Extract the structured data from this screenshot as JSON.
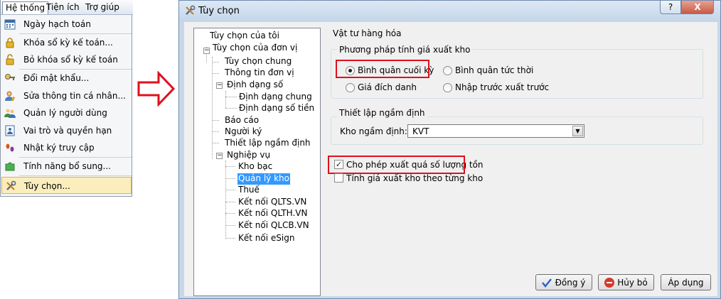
{
  "menu": {
    "bar": [
      "Hệ thống",
      "Tiện ích",
      "Trợ giúp"
    ],
    "items": [
      {
        "label": "Ngày hạch toán",
        "icon": "calendar-icon"
      },
      {
        "label": "Khóa sổ kỳ kế toán...",
        "icon": "lock-icon"
      },
      {
        "label": "Bỏ khóa sổ kỳ kế toán",
        "icon": "unlock-icon"
      },
      {
        "label": "Đổi mật khẩu...",
        "icon": "key-icon"
      },
      {
        "label": "Sửa thông tin cá nhân...",
        "icon": "user-edit-icon"
      },
      {
        "label": "Quản lý người dùng",
        "icon": "users-icon"
      },
      {
        "label": "Vai trò và quyền hạn",
        "icon": "role-icon"
      },
      {
        "label": "Nhật ký truy cập",
        "icon": "footprint-icon"
      },
      {
        "label": "Tính năng bổ sung...",
        "icon": "puzzle-icon"
      },
      {
        "label": "Tùy chọn...",
        "icon": "tools-icon"
      }
    ]
  },
  "dialog": {
    "title": "Tùy chọn",
    "help": "?",
    "close": "X",
    "tree": [
      "Tùy chọn của tôi",
      "Tùy chọn của đơn vị",
      "Tùy chọn chung",
      "Thông tin đơn vị",
      "Định dạng số",
      "Định dạng chung",
      "Định dạng số tiền",
      "Báo cáo",
      "Người ký",
      "Thiết lập ngầm định",
      "Nghiệp vụ",
      "Kho bạc",
      "Quản lý kho",
      "Thuế",
      "Kết nối QLTS.VN",
      "Kết nối QLTH.VN",
      "Kết nối QLCB.VN",
      "Kết nối eSign"
    ],
    "section_title": "Vật tư hàng hóa",
    "method_group": "Phương pháp tính giá xuất kho",
    "methods": [
      "Bình quân cuối kỳ",
      "Bình quân tức thời",
      "Giá đích danh",
      "Nhập trước xuất trước"
    ],
    "default_group": "Thiết lập ngầm định",
    "warehouse_label": "Kho ngầm định:",
    "warehouse_value": "KVT",
    "allow_over": "Cho phép xuất quá số lượng tồn",
    "per_warehouse": "Tính giá xuất kho theo từng kho",
    "buttons": {
      "ok": "Đồng ý",
      "cancel": "Hủy bỏ",
      "apply": "Áp dụng"
    }
  },
  "colors": {
    "highlight_red": "#e0101e",
    "tree_selection": "#3399ff",
    "arrow_red": "#e0101e"
  }
}
